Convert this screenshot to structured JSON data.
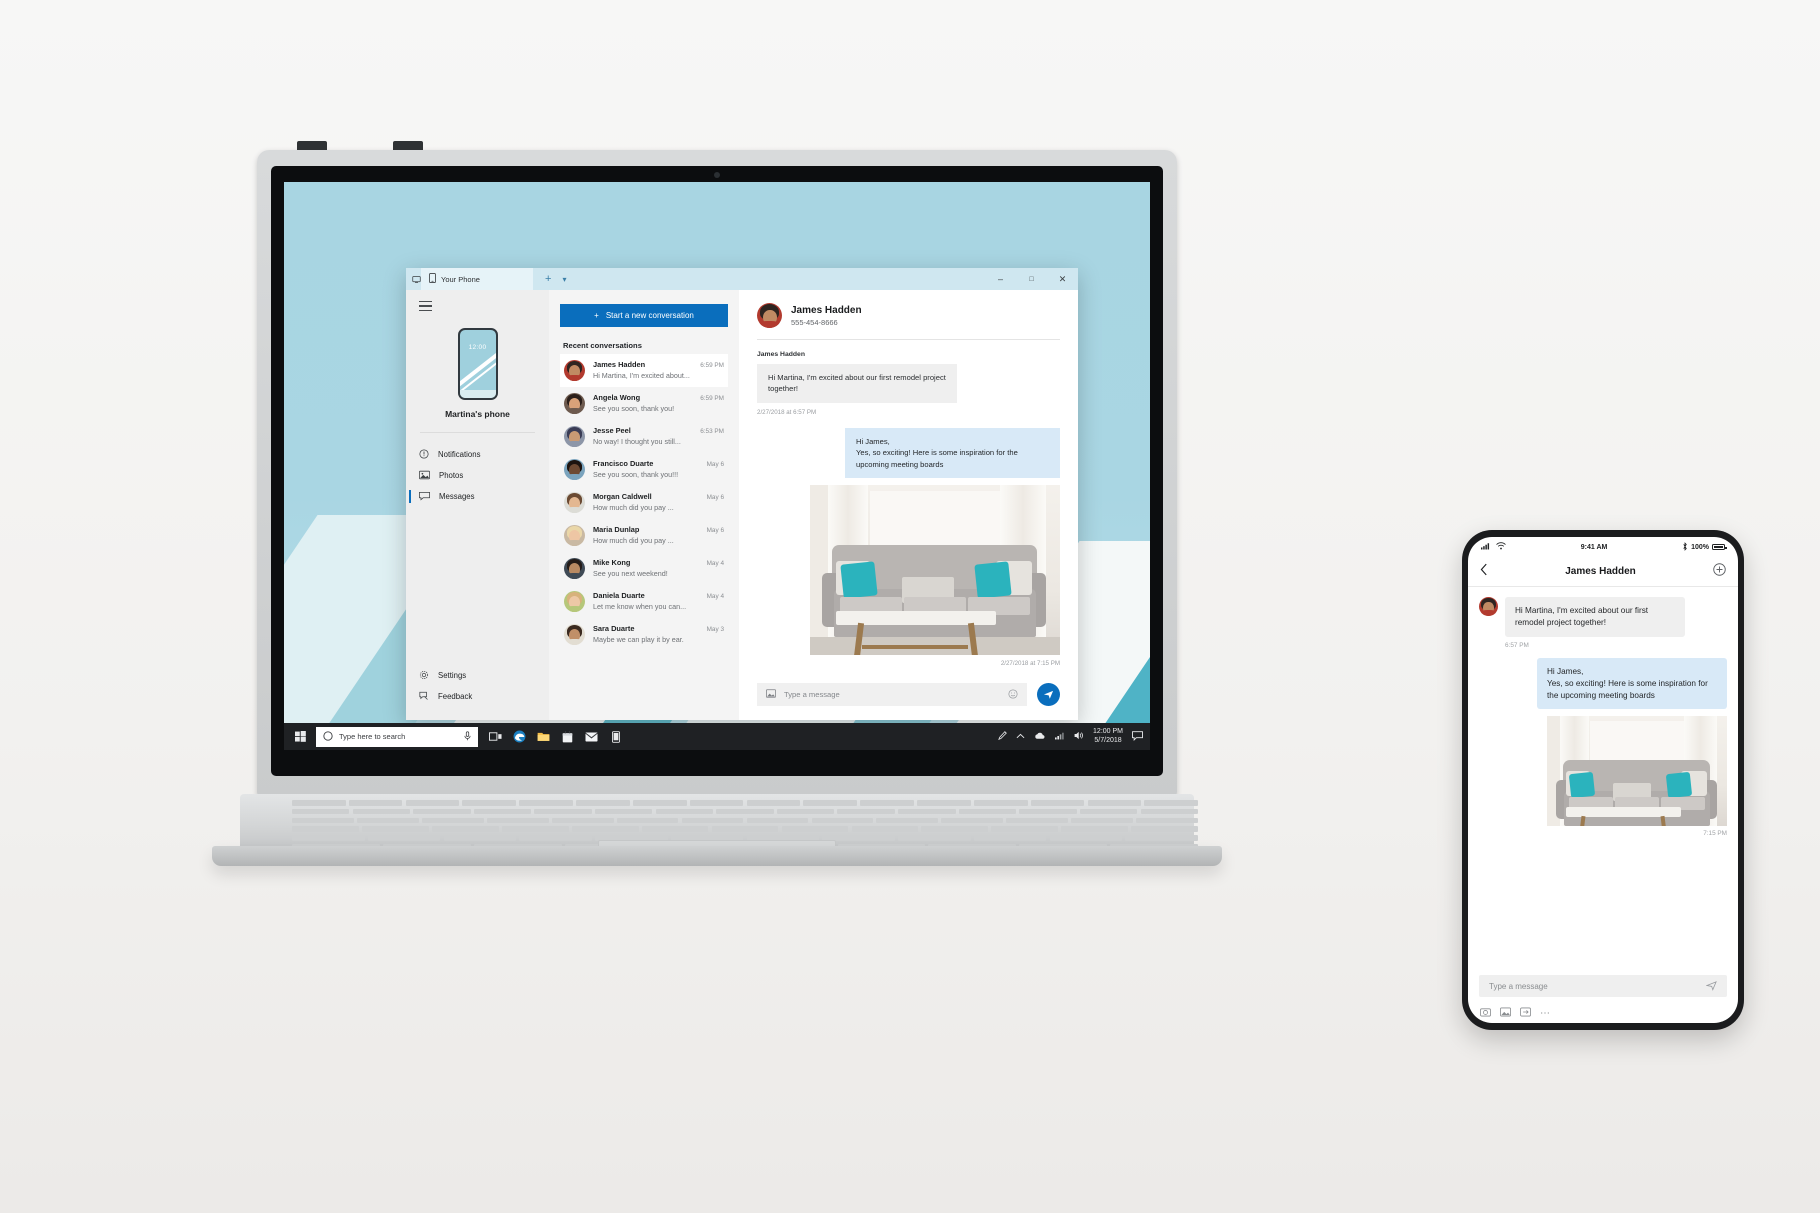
{
  "app": {
    "window_title": "Your Phone",
    "tab_label": "Your Phone",
    "new_tab_icon": "plus-icon",
    "tab_menu_icon": "chevron-down-icon",
    "minimize_label": "–",
    "maximize_label": "□",
    "close_label": "✕"
  },
  "sidebar": {
    "menu_icon": "hamburger-icon",
    "device_name": "Martina's phone",
    "device_clock": "12:00",
    "items": [
      {
        "label": "Notifications",
        "icon": "bell-circle-icon",
        "selected": false
      },
      {
        "label": "Photos",
        "icon": "photo-icon",
        "selected": false
      },
      {
        "label": "Messages",
        "icon": "message-icon",
        "selected": true
      }
    ],
    "bottom_items": [
      {
        "label": "Settings",
        "icon": "gear-icon"
      },
      {
        "label": "Feedback",
        "icon": "feedback-icon"
      }
    ]
  },
  "conversation_list": {
    "new_conversation_label": "Start a new conversation",
    "new_conversation_icon": "plus-icon",
    "section_header": "Recent conversations",
    "items": [
      {
        "name": "James Hadden",
        "preview": "Hi Martina, I'm excited about...",
        "time": "6:59 PM",
        "active": true,
        "hair": "#2e2420",
        "skin": "#c08a63",
        "body": "#b23a2e"
      },
      {
        "name": "Angela Wong",
        "preview": "See you soon, thank you!",
        "time": "6:59 PM",
        "active": false,
        "hair": "#2b1f1a",
        "skin": "#d9a279",
        "body": "#6d5a4e"
      },
      {
        "name": "Jesse Peel",
        "preview": "No way! I thought you still...",
        "time": "6:53 PM",
        "active": false,
        "hair": "#3a3c55",
        "skin": "#c99a74",
        "body": "#8d96a8"
      },
      {
        "name": "Francisco Duarte",
        "preview": "See you soon, thank you!!!",
        "time": "May 6",
        "active": false,
        "hair": "#1d1410",
        "skin": "#6e4a33",
        "body": "#7aa3bd"
      },
      {
        "name": "Morgan Caldwell",
        "preview": "How much did you pay ...",
        "time": "May 6",
        "active": false,
        "hair": "#6b4a33",
        "skin": "#e3b791",
        "body": "#dcdcd6"
      },
      {
        "name": "Maria Dunlap",
        "preview": "How much did you pay ...",
        "time": "May 6",
        "active": false,
        "hair": "#ead7a8",
        "skin": "#eec6a4",
        "body": "#c9b9a3"
      },
      {
        "name": "Mike Kong",
        "preview": "See you next weekend!",
        "time": "May 4",
        "active": false,
        "hair": "#241c18",
        "skin": "#b98a62",
        "body": "#3f4a55"
      },
      {
        "name": "Daniela Duarte",
        "preview": "Let me know when you can...",
        "time": "May 4",
        "active": false,
        "hair": "#d7b27c",
        "skin": "#edc8a6",
        "body": "#b6c77a"
      },
      {
        "name": "Sara Duarte",
        "preview": "Maybe we can play it by ear.",
        "time": "May 3",
        "active": false,
        "hair": "#3b2a20",
        "skin": "#c08f68",
        "body": "#e2ddd2"
      }
    ]
  },
  "thread": {
    "contact_name": "James Hadden",
    "contact_phone": "555-454-8666",
    "incoming_sender": "James Hadden",
    "incoming_text": "Hi Martina, I'm excited about our first remodel project together!",
    "incoming_stamp": "2/27/2018 at 6:57 PM",
    "outgoing_text": "Hi James,\nYes, so exciting! Here is some inspiration for the upcoming meeting boards",
    "outgoing_stamp": "2/27/2018 at 7:15 PM",
    "photo_alt": "living-room-sofa-photo",
    "compose_placeholder": "Type a message",
    "attach_icon": "image-icon",
    "emoji_icon": "emoji-icon",
    "send_icon": "send-icon"
  },
  "taskbar": {
    "start_icon": "windows-start-icon",
    "search_placeholder": "Type here to search",
    "search_icon": "search-circle-icon",
    "mic_icon": "microphone-icon",
    "pinned": [
      {
        "icon": "task-view-icon"
      },
      {
        "icon": "edge-icon"
      },
      {
        "icon": "file-explorer-icon"
      },
      {
        "icon": "store-icon"
      },
      {
        "icon": "mail-icon"
      },
      {
        "icon": "your-phone-icon"
      }
    ],
    "tray": [
      {
        "icon": "pen-icon"
      },
      {
        "icon": "chevron-up-icon"
      },
      {
        "icon": "onedrive-icon"
      },
      {
        "icon": "network-icon"
      },
      {
        "icon": "volume-icon"
      }
    ],
    "clock_time": "12:00 PM",
    "clock_date": "5/7/2018",
    "action_center_icon": "action-center-icon"
  },
  "phone": {
    "status_signal_icon": "signal-icon",
    "status_wifi_icon": "wifi-icon",
    "status_time": "9:41 AM",
    "status_bluetooth_icon": "bluetooth-icon",
    "status_battery_pct": "100%",
    "back_icon": "back-chevron-icon",
    "title": "James Hadden",
    "add_icon": "add-circle-icon",
    "incoming_text": "Hi Martina, I'm excited about our first remodel project together!",
    "incoming_stamp": "6:57 PM",
    "outgoing_text": "Hi James,\nYes, so exciting! Here is some inspiration for the upcoming meeting boards",
    "outgoing_stamp": "7:15 PM",
    "compose_placeholder": "Type a message",
    "tools": [
      {
        "icon": "camera-icon"
      },
      {
        "icon": "gallery-icon"
      },
      {
        "icon": "sticker-icon"
      },
      {
        "icon": "more-icon"
      }
    ]
  },
  "colors": {
    "accent_blue": "#0a6ebd",
    "bubble_out": "#d8e9f7",
    "bubble_in": "#efefef",
    "title_bar": "#cfe7f0",
    "wallpaper": "#a8d5e2"
  }
}
